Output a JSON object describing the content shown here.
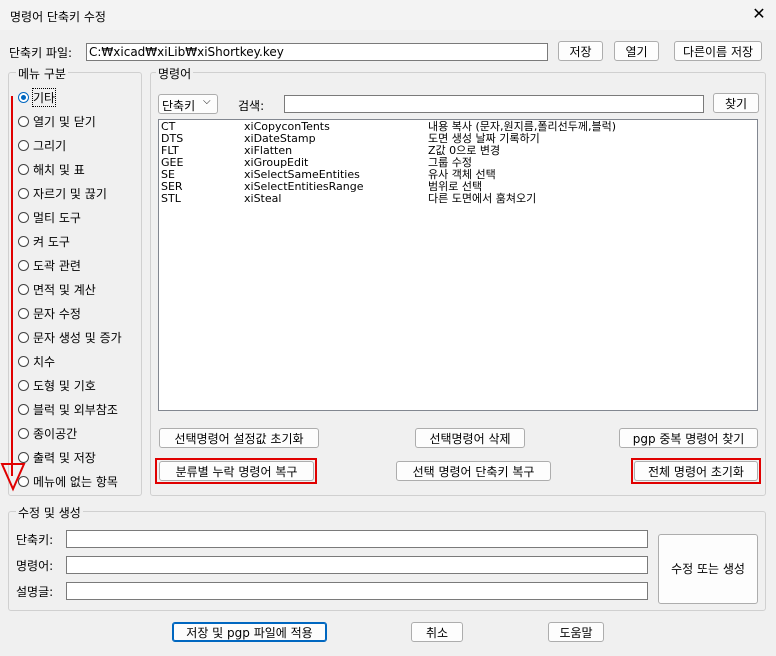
{
  "window": {
    "title": "명령어 단축키 수정",
    "close_icon": "close-icon"
  },
  "file_row": {
    "label": "단축키 파일:",
    "path": "C:₩xicad₩xiLib₩xiShortkey.key",
    "save": "저장",
    "open": "열기",
    "save_as": "다른이름 저장"
  },
  "menu": {
    "legend": "메뉴 구분",
    "selected_index": 0,
    "items": [
      "기타",
      "열기 및 닫기",
      "그리기",
      "해치 및 표",
      "자르기 및 끊기",
      "멀티 도구",
      "켜 도구",
      "도곽 관련",
      "면적 및 계산",
      "문자 수정",
      "문자 생성 및 증가",
      "치수",
      "도형 및 기호",
      "블럭 및 외부참조",
      "종이공간",
      "출력 및 저장",
      "메뉴에 없는 항목"
    ]
  },
  "commands": {
    "legend": "명령어",
    "filter_value": "단축키",
    "search_label": "검색:",
    "search_value": "",
    "find": "찾기",
    "rows": [
      {
        "key": "CT",
        "cmd": "xiCopyconTents",
        "desc": "내용 복사 (문자,원지름,폴리선두께,블럭)"
      },
      {
        "key": "DTS",
        "cmd": "xiDateStamp",
        "desc": "도면 생성 날짜 기록하기"
      },
      {
        "key": "FLT",
        "cmd": "xiFlatten",
        "desc": "Z값 0으로 변경"
      },
      {
        "key": "GEE",
        "cmd": "xiGroupEdit",
        "desc": "그룹 수정"
      },
      {
        "key": "SE",
        "cmd": "xiSelectSameEntities",
        "desc": "유사 객체 선택"
      },
      {
        "key": "SER",
        "cmd": "xiSelectEntitiesRange",
        "desc": "범위로 선택"
      },
      {
        "key": "STL",
        "cmd": "xiSteal",
        "desc": "다른 도면에서 훔쳐오기"
      }
    ],
    "btn_reset_settings": "선택명령어 설정값 초기화",
    "btn_delete": "선택명령어 삭제",
    "btn_find_dup": "pgp 중복 명령어 찾기",
    "btn_restore_missing": "분류별 누락 명령어 복구",
    "btn_restore_selected": "선택 명령어 단축키 복구",
    "btn_reset_all": "전체 명령어 초기화"
  },
  "edit": {
    "legend": "수정 및 생성",
    "shortcut_label": "단축키:",
    "command_label": "명령어:",
    "description_label": "설명글:",
    "shortcut_value": "",
    "command_value": "",
    "description_value": "",
    "apply": "수정 또는 생성"
  },
  "footer": {
    "save_apply": "저장 및 pgp 파일에 적용",
    "cancel": "취소",
    "help": "도움말"
  },
  "colors": {
    "annotation_red": "#e00000",
    "accent": "#0067c0"
  }
}
